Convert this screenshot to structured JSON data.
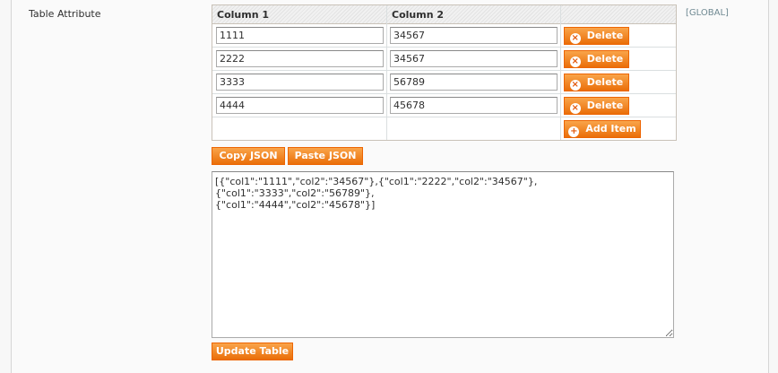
{
  "field": {
    "label": "Table Attribute",
    "scope": "[GLOBAL]"
  },
  "grid": {
    "columns": [
      "Column 1",
      "Column 2"
    ],
    "rows": [
      {
        "col1": "1111",
        "col2": "34567",
        "action": "Delete"
      },
      {
        "col1": "2222",
        "col2": "34567",
        "action": "Delete"
      },
      {
        "col1": "3333",
        "col2": "56789",
        "action": "Delete"
      },
      {
        "col1": "4444",
        "col2": "45678",
        "action": "Delete"
      }
    ],
    "add_label": "Add Item"
  },
  "toolbar": {
    "copy_label": "Copy JSON",
    "paste_label": "Paste JSON"
  },
  "json_value": "[{\"col1\":\"1111\",\"col2\":\"34567\"},{\"col1\":\"2222\",\"col2\":\"34567\"},{\"col1\":\"3333\",\"col2\":\"56789\"},\n{\"col1\":\"4444\",\"col2\":\"45678\"}]",
  "update_label": "Update Table",
  "icons": {
    "delete": "delete-icon",
    "add": "add-icon"
  },
  "colors": {
    "button": "#ea6e09",
    "scope": "#6f8992"
  }
}
